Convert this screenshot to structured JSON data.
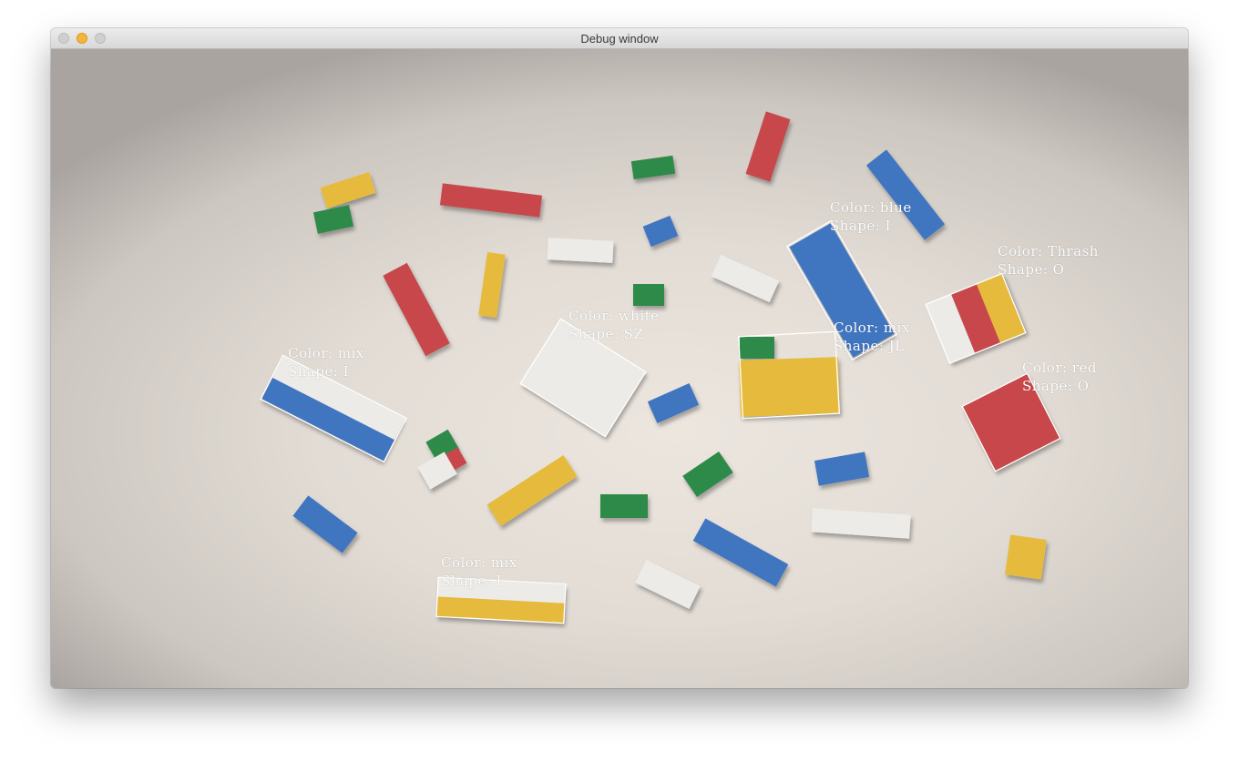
{
  "window": {
    "title": "Debug window"
  },
  "detections": [
    {
      "color_text": "Color: blue",
      "shape_text": "Shape: I"
    },
    {
      "color_text": "Color: Thrash",
      "shape_text": "Shape: O"
    },
    {
      "color_text": "Color: white",
      "shape_text": "Shape: SZ"
    },
    {
      "color_text": "Color: mix",
      "shape_text": "Shape: JL"
    },
    {
      "color_text": "Color: mix",
      "shape_text": "Shape: I"
    },
    {
      "color_text": "Color: red",
      "shape_text": "Shape: O"
    },
    {
      "color_text": "Color: mix",
      "shape_text": "Shape: I"
    }
  ],
  "colors": {
    "red": "#c8474c",
    "blue": "#3f74c0",
    "yellow": "#e6bb3d",
    "green": "#2f8a4a",
    "white": "#ecebe8",
    "box_outline": "#ffffff"
  }
}
